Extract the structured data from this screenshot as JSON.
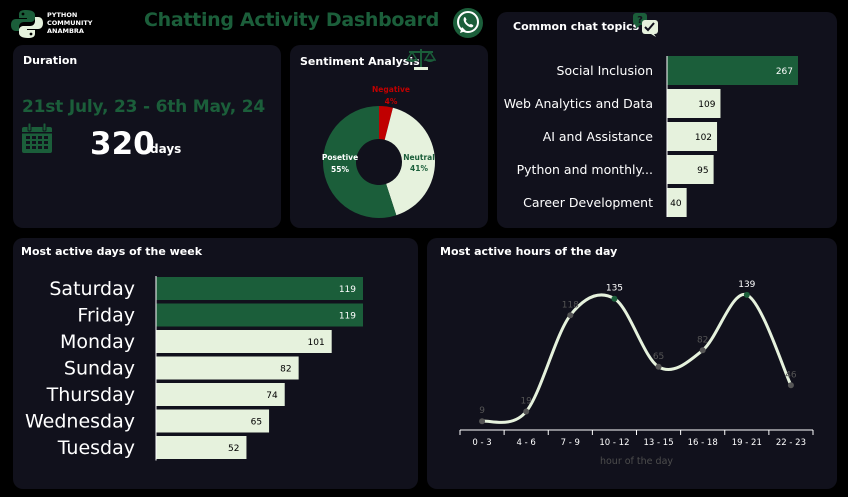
{
  "header": {
    "logo_lines": [
      "PYTHON",
      "COMMUNITY",
      "ANAMBRA"
    ],
    "title": "Chatting Activity Dashboard"
  },
  "duration": {
    "title": "Duration",
    "range": "21st July, 23 - 6th May, 24",
    "days": "320",
    "unit": "days"
  },
  "sentiment": {
    "title": "Sentiment Analysis"
  },
  "topics": {
    "title": "Common chat topics"
  },
  "days_week": {
    "title": "Most active days of the week"
  },
  "hours_day": {
    "title": "Most active hours of the day"
  },
  "colors": {
    "background": "#000000",
    "card": "#11111c",
    "accent_green": "#1b5e3a",
    "light_green": "#e6f2dd",
    "negative_red": "#c00000",
    "line": "#e6f2dd",
    "marker": "#555555"
  },
  "chart_data": [
    {
      "type": "pie",
      "title": "Sentiment Analysis",
      "categories": [
        "Negative",
        "Neutral",
        "Posetive"
      ],
      "values": [
        4,
        41,
        55
      ],
      "labels": [
        "4%",
        "41%",
        "55%"
      ],
      "colors": [
        "#c00000",
        "#e6f2dd",
        "#1b5e3a"
      ]
    },
    {
      "type": "bar",
      "orientation": "horizontal",
      "title": "Common chat topics",
      "categories": [
        "Social Inclusion",
        "Web Analytics and Data",
        "AI and Assistance",
        "Python and monthly...",
        "Career Development"
      ],
      "values": [
        267,
        109,
        102,
        95,
        40
      ]
    },
    {
      "type": "bar",
      "orientation": "horizontal",
      "title": "Most active days of the week",
      "categories": [
        "Saturday",
        "Friday",
        "Monday",
        "Sunday",
        "Thursday",
        "Wednesday",
        "Tuesday"
      ],
      "values": [
        119,
        119,
        101,
        82,
        74,
        65,
        52
      ]
    },
    {
      "type": "line",
      "title": "Most active hours of the day",
      "categories": [
        "0 - 3",
        "4 - 6",
        "7 - 9",
        "10 - 12",
        "13 - 15",
        "16 - 18",
        "19 - 21",
        "22 - 23"
      ],
      "values": [
        9,
        19,
        118,
        135,
        65,
        82,
        139,
        46
      ],
      "xlabel": "hour of the day",
      "smooth": true
    }
  ]
}
